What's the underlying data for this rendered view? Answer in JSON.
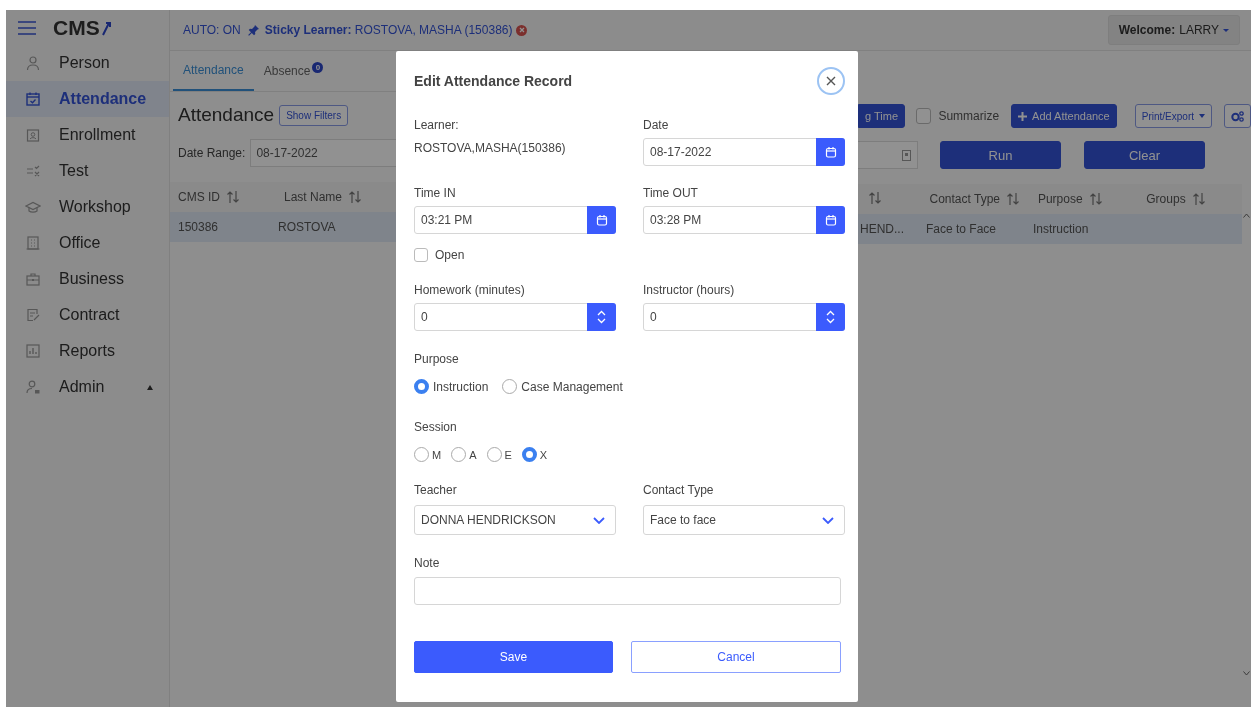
{
  "header": {
    "brand": "CMS",
    "auto": "AUTO: ON",
    "sticky_label": "Sticky Learner:",
    "sticky_value": "ROSTOVA, MASHA (150386)",
    "welcome_label": "Welcome:",
    "welcome_user": "LARRY"
  },
  "sidebar": {
    "items": [
      {
        "label": "Person",
        "kind": "link",
        "selected": false
      },
      {
        "label": "Attendance",
        "kind": "link",
        "selected": true
      },
      {
        "label": "Enrollment",
        "kind": "link",
        "selected": false
      },
      {
        "label": "Test",
        "kind": "link",
        "selected": false
      },
      {
        "label": "Workshop",
        "kind": "link",
        "selected": false
      },
      {
        "label": "Office",
        "kind": "link",
        "selected": false
      },
      {
        "label": "Business",
        "kind": "link",
        "selected": false
      },
      {
        "label": "Contract",
        "kind": "link",
        "selected": false
      },
      {
        "label": "Reports",
        "kind": "link",
        "selected": false
      },
      {
        "label": "Admin",
        "kind": "group",
        "selected": false
      }
    ]
  },
  "tabs": [
    {
      "label": "Attendance",
      "selected": true
    },
    {
      "label": "Absence",
      "selected": false,
      "badge": "0"
    }
  ],
  "page": {
    "title": "Attendance",
    "show_filters": "Show Filters",
    "date_range_label": "Date Range:",
    "date_range_value": "08-17-2022",
    "time_button": "g Time",
    "summarize": {
      "label": "Summarize",
      "checked": false
    },
    "add_button": "Add Attendance",
    "print_button": "Print/Export",
    "run_button": "Run",
    "clear_button": "Clear"
  },
  "table": {
    "left_columns": [
      "CMS ID",
      "Last Name"
    ],
    "right_columns": [
      {
        "kind": "sort-only"
      },
      {
        "kind": "label",
        "label": "Contact Type"
      },
      {
        "kind": "label",
        "label": "Purpose"
      },
      {
        "kind": "label",
        "label": "Groups"
      }
    ],
    "rows": [
      {
        "selected": true,
        "left_cells": [
          "150386",
          "ROSTOVA"
        ],
        "right_cells": [
          "HEND...",
          "Face to Face",
          "Instruction"
        ]
      }
    ]
  },
  "dialog": {
    "title": "Edit Attendance Record",
    "learner": {
      "label": "Learner:",
      "value": "ROSTOVA,MASHA(150386)"
    },
    "date": {
      "label": "Date",
      "value": "08-17-2022"
    },
    "time_in": {
      "label": "Time IN",
      "value": "03:21 PM"
    },
    "time_out": {
      "label": "Time OUT",
      "value": "03:28 PM"
    },
    "open": {
      "label": "Open",
      "checked": false
    },
    "homework": {
      "label": "Homework (minutes)",
      "value": "0"
    },
    "instructor": {
      "label": "Instructor (hours)",
      "value": "0"
    },
    "purpose": {
      "label": "Purpose",
      "options": [
        {
          "label": "Instruction",
          "selected": true
        },
        {
          "label": "Case Management",
          "selected": false
        }
      ]
    },
    "session": {
      "label": "Session",
      "options": [
        {
          "label": "M",
          "selected": false
        },
        {
          "label": "A",
          "selected": false
        },
        {
          "label": "E",
          "selected": false
        },
        {
          "label": "X",
          "selected": true
        }
      ]
    },
    "teacher": {
      "label": "Teacher",
      "value": "DONNA HENDRICKSON"
    },
    "contact_type": {
      "label": "Contact Type",
      "value": "Face to face"
    },
    "note": {
      "label": "Note"
    },
    "buttons": [
      {
        "label": "Save",
        "kind": "primary"
      },
      {
        "label": "Cancel",
        "kind": "outline"
      }
    ]
  }
}
